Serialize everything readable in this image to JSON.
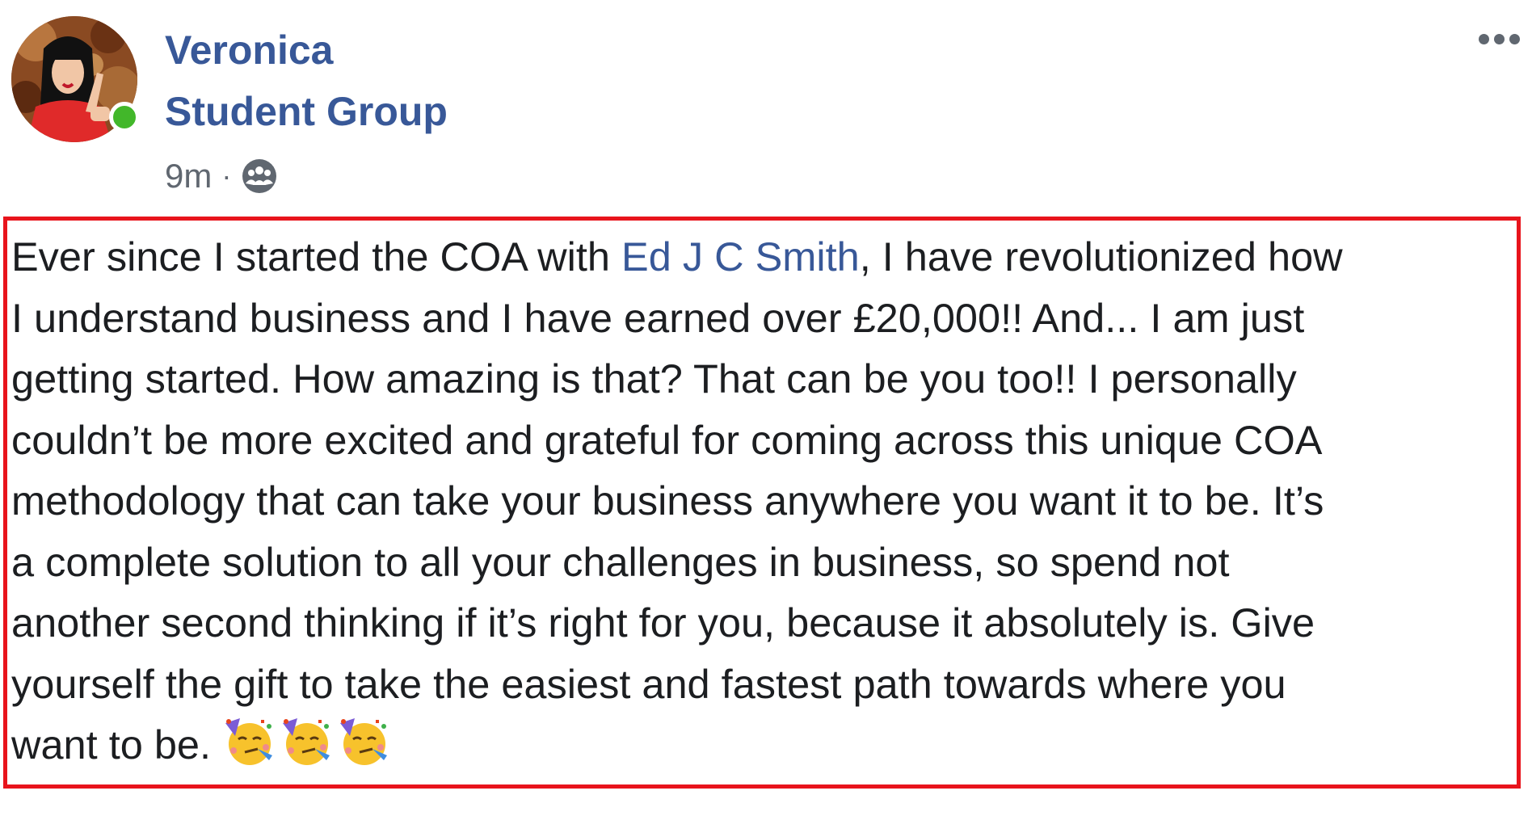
{
  "post": {
    "author_name": "Veronica",
    "group_name": "Student Group",
    "timestamp": "9m",
    "separator": "·",
    "audience_icon": "group-audience-icon",
    "more_icon": "more-options-icon",
    "body": {
      "line1_before": "Ever since I started the COA with ",
      "mention": "Ed J C Smith",
      "line1_after": ", I have revolutionized how",
      "line2": "I understand business and I have earned over £20,000!! And... I am just",
      "line3": "getting started. How amazing is that? That can be you too!! I personally",
      "line4": "couldn’t be more excited and grateful for coming across this unique COA",
      "line5": "methodology that can take your business anywhere you want it to be. It’s",
      "line6": "a complete solution to all your challenges in business, so spend not",
      "line7": "another second thinking if it’s right for you, because it absolutely is. Give",
      "line8": "yourself the gift to take the easiest and fastest path towards where you",
      "line9": "want to be. "
    },
    "emojis": [
      "partying-face-emoji",
      "partying-face-emoji",
      "partying-face-emoji"
    ],
    "colors": {
      "link": "#385898",
      "text": "#1c1e21",
      "meta": "#606770",
      "online": "#42b72a",
      "highlight_border": "#e8141c"
    }
  }
}
